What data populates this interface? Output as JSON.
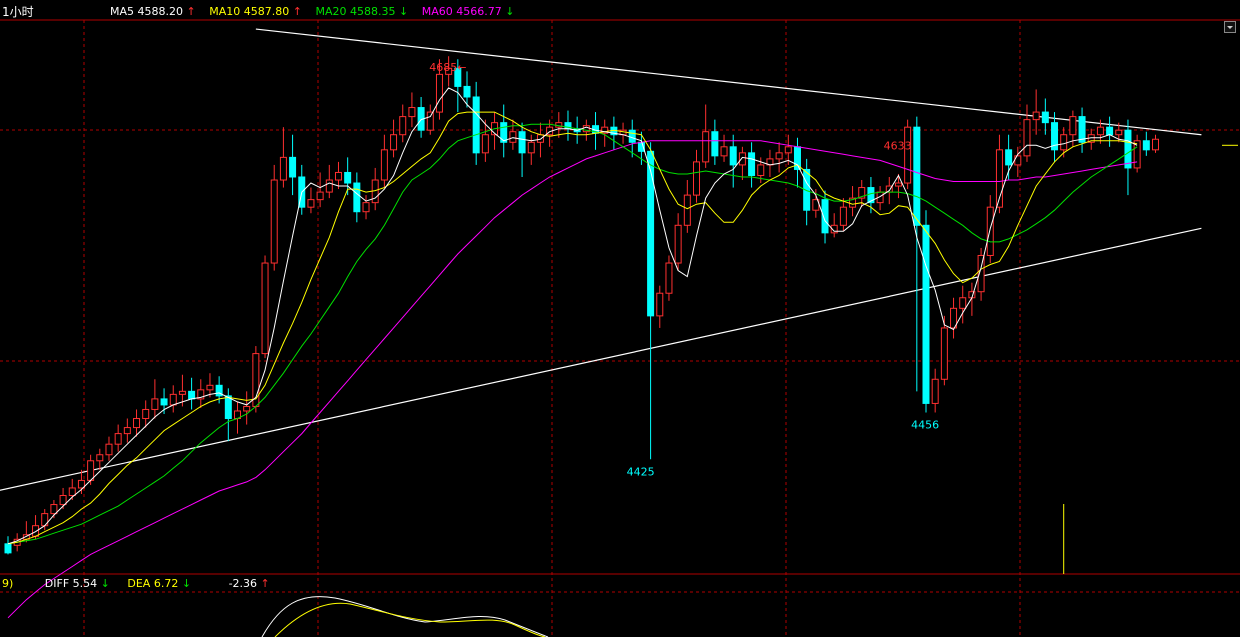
{
  "period_label": "1小时",
  "ma_legend": [
    {
      "label": "MA5",
      "value": "4588.20",
      "arrow": "↑",
      "color": "#ffffff",
      "arrow_color": "#ff3030"
    },
    {
      "label": "MA10",
      "value": "4587.80",
      "arrow": "↑",
      "color": "#ffff00",
      "arrow_color": "#ff3030"
    },
    {
      "label": "MA20",
      "value": "4588.35",
      "arrow": "↓",
      "color": "#00e000",
      "arrow_color": "#00e000"
    },
    {
      "label": "MA60",
      "value": "4566.77",
      "arrow": "↓",
      "color": "#ff00ff",
      "arrow_color": "#00e000"
    }
  ],
  "macd_legend": {
    "prefix": "9)",
    "diff_label": "DIFF",
    "diff_value": "5.54",
    "diff_arrow": "↓",
    "dea_label": "DEA",
    "dea_value": "6.72",
    "dea_arrow": "↓",
    "macd_value": "-2.36",
    "macd_arrow": "↑"
  },
  "colors": {
    "up": "#ff3030",
    "down": "#00ffff",
    "grid": "#b00000",
    "ma5": "#ffffff",
    "ma10": "#ffff00",
    "ma20": "#00e000",
    "ma60": "#ff00ff",
    "trendline": "#ffffff",
    "label_high": "#ff3030",
    "label_low": "#00ffff"
  },
  "chart_data": {
    "type": "candlestick",
    "ylim": [
      4349,
      4716
    ],
    "price_labels": [
      {
        "text": "4685←",
        "price": 4685,
        "bar": 49
      },
      {
        "text": "4633",
        "price": 4633,
        "bar": 98
      },
      {
        "text": "4425",
        "price": 4425,
        "bar": 70
      },
      {
        "text": "4456",
        "price": 4456,
        "bar": 101
      }
    ],
    "candles": [
      [
        4369,
        4374,
        4363,
        4362
      ],
      [
        4368,
        4376,
        4372,
        4364
      ],
      [
        4372,
        4384,
        4375,
        4370
      ],
      [
        4374,
        4388,
        4381,
        4372
      ],
      [
        4381,
        4392,
        4389,
        4378
      ],
      [
        4389,
        4398,
        4395,
        4386
      ],
      [
        4395,
        4406,
        4401,
        4392
      ],
      [
        4401,
        4412,
        4406,
        4398
      ],
      [
        4406,
        4418,
        4411,
        4402
      ],
      [
        4411,
        4428,
        4424,
        4408
      ],
      [
        4424,
        4432,
        4428,
        4418
      ],
      [
        4428,
        4440,
        4435,
        4424
      ],
      [
        4435,
        4448,
        4442,
        4430
      ],
      [
        4442,
        4452,
        4446,
        4436
      ],
      [
        4446,
        4458,
        4452,
        4440
      ],
      [
        4452,
        4464,
        4458,
        4446
      ],
      [
        4458,
        4478,
        4465,
        4452
      ],
      [
        4465,
        4472,
        4461,
        4455
      ],
      [
        4461,
        4474,
        4468,
        4456
      ],
      [
        4468,
        4481,
        4470,
        4460
      ],
      [
        4470,
        4479,
        4465,
        4458
      ],
      [
        4465,
        4478,
        4471,
        4459
      ],
      [
        4471,
        4482,
        4474,
        4466
      ],
      [
        4474,
        4480,
        4467,
        4462
      ],
      [
        4467,
        4472,
        4452,
        4437
      ],
      [
        4452,
        4463,
        4457,
        4442
      ],
      [
        4457,
        4470,
        4460,
        4448
      ],
      [
        4460,
        4500,
        4495,
        4456
      ],
      [
        4495,
        4560,
        4555,
        4492
      ],
      [
        4555,
        4620,
        4610,
        4550
      ],
      [
        4610,
        4645,
        4625,
        4605
      ],
      [
        4625,
        4640,
        4612,
        4600
      ],
      [
        4612,
        4620,
        4592,
        4587
      ],
      [
        4592,
        4605,
        4597,
        4588
      ],
      [
        4597,
        4615,
        4602,
        4592
      ],
      [
        4602,
        4620,
        4610,
        4598
      ],
      [
        4610,
        4622,
        4615,
        4604
      ],
      [
        4615,
        4625,
        4608,
        4600
      ],
      [
        4608,
        4615,
        4589,
        4582
      ],
      [
        4589,
        4600,
        4595,
        4584
      ],
      [
        4595,
        4618,
        4610,
        4590
      ],
      [
        4610,
        4640,
        4630,
        4605
      ],
      [
        4630,
        4650,
        4640,
        4625
      ],
      [
        4640,
        4660,
        4652,
        4635
      ],
      [
        4652,
        4668,
        4658,
        4645
      ],
      [
        4658,
        4665,
        4643,
        4638
      ],
      [
        4643,
        4660,
        4655,
        4640
      ],
      [
        4655,
        4690,
        4680,
        4650
      ],
      [
        4680,
        4692,
        4684,
        4672
      ],
      [
        4684,
        4690,
        4672,
        4655
      ],
      [
        4672,
        4682,
        4665,
        4658
      ],
      [
        4665,
        4675,
        4628,
        4620
      ],
      [
        4628,
        4650,
        4640,
        4622
      ],
      [
        4640,
        4655,
        4648,
        4630
      ],
      [
        4648,
        4660,
        4635,
        4625
      ],
      [
        4635,
        4650,
        4642,
        4630
      ],
      [
        4642,
        4648,
        4628,
        4612
      ],
      [
        4628,
        4640,
        4635,
        4620
      ],
      [
        4635,
        4648,
        4640,
        4625
      ],
      [
        4640,
        4650,
        4645,
        4632
      ],
      [
        4645,
        4655,
        4648,
        4638
      ],
      [
        4648,
        4656,
        4644,
        4636
      ],
      [
        4644,
        4652,
        4642,
        4634
      ],
      [
        4642,
        4650,
        4646,
        4636
      ],
      [
        4646,
        4655,
        4641,
        4630
      ],
      [
        4641,
        4650,
        4645,
        4632
      ],
      [
        4645,
        4652,
        4640,
        4630
      ],
      [
        4640,
        4648,
        4643,
        4634
      ],
      [
        4643,
        4650,
        4635,
        4625
      ],
      [
        4635,
        4642,
        4629,
        4620
      ],
      [
        4629,
        4635,
        4520,
        4425
      ],
      [
        4520,
        4540,
        4535,
        4512
      ],
      [
        4535,
        4560,
        4555,
        4530
      ],
      [
        4555,
        4588,
        4580,
        4550
      ],
      [
        4580,
        4610,
        4600,
        4575
      ],
      [
        4600,
        4630,
        4622,
        4595
      ],
      [
        4622,
        4660,
        4642,
        4618
      ],
      [
        4642,
        4650,
        4626,
        4620
      ],
      [
        4626,
        4640,
        4632,
        4622
      ],
      [
        4632,
        4640,
        4620,
        4605
      ],
      [
        4620,
        4632,
        4628,
        4610
      ],
      [
        4628,
        4635,
        4613,
        4605
      ],
      [
        4613,
        4625,
        4620,
        4608
      ],
      [
        4620,
        4630,
        4624,
        4612
      ],
      [
        4624,
        4635,
        4628,
        4615
      ],
      [
        4628,
        4640,
        4632,
        4620
      ],
      [
        4632,
        4638,
        4617,
        4605
      ],
      [
        4617,
        4624,
        4590,
        4580
      ],
      [
        4590,
        4604,
        4597,
        4585
      ],
      [
        4597,
        4603,
        4575,
        4568
      ],
      [
        4575,
        4588,
        4580,
        4572
      ],
      [
        4580,
        4598,
        4592,
        4576
      ],
      [
        4592,
        4606,
        4598,
        4586
      ],
      [
        4598,
        4610,
        4605,
        4592
      ],
      [
        4605,
        4612,
        4595,
        4588
      ],
      [
        4595,
        4606,
        4602,
        4590
      ],
      [
        4602,
        4612,
        4606,
        4594
      ],
      [
        4606,
        4614,
        4608,
        4598
      ],
      [
        4608,
        4650,
        4645,
        4604
      ],
      [
        4645,
        4652,
        4580,
        4470
      ],
      [
        4580,
        4590,
        4462,
        4456
      ],
      [
        4462,
        4485,
        4478,
        4456
      ],
      [
        4478,
        4520,
        4512,
        4474
      ],
      [
        4512,
        4532,
        4525,
        4505
      ],
      [
        4525,
        4540,
        4532,
        4515
      ],
      [
        4532,
        4542,
        4536,
        4520
      ],
      [
        4536,
        4565,
        4560,
        4530
      ],
      [
        4560,
        4600,
        4592,
        4555
      ],
      [
        4592,
        4640,
        4630,
        4588
      ],
      [
        4630,
        4640,
        4620,
        4610
      ],
      [
        4620,
        4632,
        4626,
        4612
      ],
      [
        4626,
        4660,
        4650,
        4622
      ],
      [
        4650,
        4670,
        4655,
        4640
      ],
      [
        4655,
        4664,
        4648,
        4640
      ],
      [
        4648,
        4655,
        4630,
        4622
      ],
      [
        4630,
        4645,
        4640,
        4625
      ],
      [
        4640,
        4656,
        4652,
        4632
      ],
      [
        4652,
        4658,
        4635,
        4628
      ],
      [
        4635,
        4644,
        4640,
        4630
      ],
      [
        4640,
        4650,
        4645,
        4634
      ],
      [
        4645,
        4652,
        4640,
        4632
      ],
      [
        4640,
        4648,
        4643,
        4635
      ],
      [
        4643,
        4650,
        4618,
        4600
      ],
      [
        4618,
        4640,
        4636,
        4615
      ],
      [
        4636,
        4642,
        4630,
        4626
      ],
      [
        4630,
        4640,
        4637,
        4628
      ]
    ],
    "ma5": [
      4369,
      4371,
      4374,
      4377,
      4381,
      4388,
      4394,
      4400,
      4405,
      4411,
      4417,
      4423,
      4429,
      4435,
      4441,
      4447,
      4453,
      4458,
      4461,
      4463,
      4465,
      4466,
      4468,
      4469,
      4466,
      4463,
      4461,
      4466,
      4484,
      4512,
      4543,
      4573,
      4602,
      4608,
      4605,
      4608,
      4606,
      4606,
      4601,
      4596,
      4598,
      4604,
      4613,
      4628,
      4642,
      4650,
      4652,
      4663,
      4671,
      4668,
      4660,
      4654,
      4647,
      4641,
      4636,
      4638,
      4637,
      4636,
      4637,
      4642,
      4644,
      4644,
      4643,
      4645,
      4643,
      4642,
      4641,
      4640,
      4638,
      4636,
      4616,
      4590,
      4565,
      4550,
      4546,
      4573,
      4598,
      4608,
      4614,
      4617,
      4625,
      4624,
      4622,
      4620,
      4621,
      4623,
      4620,
      4608,
      4600,
      4583,
      4576,
      4576,
      4581,
      4593,
      4596,
      4599,
      4603,
      4613,
      4600,
      4572,
      4553,
      4537,
      4514,
      4511,
      4522,
      4532,
      4552,
      4578,
      4598,
      4616,
      4627,
      4633,
      4633,
      4631,
      4633,
      4634,
      4636,
      4637,
      4638,
      4638,
      4640,
      4637,
      4636,
      4633
    ],
    "ma10": [
      4369,
      4370,
      4372,
      4374,
      4377,
      4380,
      4383,
      4387,
      4392,
      4396,
      4402,
      4409,
      4415,
      4421,
      4426,
      4432,
      4438,
      4444,
      4448,
      4452,
      4456,
      4460,
      4463,
      4465,
      4466,
      4465,
      4464,
      4465,
      4474,
      4488,
      4502,
      4515,
      4529,
      4544,
      4558,
      4572,
      4589,
      4604,
      4604,
      4602,
      4603,
      4605,
      4609,
      4614,
      4619,
      4624,
      4628,
      4638,
      4649,
      4654,
      4655,
      4655,
      4655,
      4655,
      4652,
      4649,
      4645,
      4642,
      4640,
      4639,
      4640,
      4641,
      4640,
      4640,
      4641,
      4642,
      4643,
      4642,
      4641,
      4640,
      4630,
      4617,
      4604,
      4594,
      4591,
      4594,
      4595,
      4588,
      4582,
      4582,
      4590,
      4600,
      4606,
      4610,
      4613,
      4618,
      4620,
      4615,
      4610,
      4601,
      4598,
      4596,
      4594,
      4595,
      4592,
      4587,
      4588,
      4593,
      4592,
      4584,
      4576,
      4568,
      4557,
      4548,
      4542,
      4545,
      4551,
      4554,
      4556,
      4566,
      4580,
      4593,
      4606,
      4614,
      4622,
      4628,
      4632,
      4634,
      4636,
      4636,
      4636,
      4636,
      4635,
      4634
    ],
    "ma20": [
      4369,
      4370,
      4371,
      4372,
      4374,
      4376,
      4378,
      4380,
      4382,
      4385,
      4388,
      4391,
      4394,
      4398,
      4402,
      4406,
      4410,
      4414,
      4419,
      4424,
      4430,
      4436,
      4441,
      4446,
      4450,
      4452,
      4455,
      4460,
      4466,
      4474,
      4482,
      4491,
      4500,
      4508,
      4517,
      4526,
      4535,
      4546,
      4556,
      4564,
      4571,
      4580,
      4591,
      4602,
      4610,
      4614,
      4618,
      4624,
      4631,
      4636,
      4638,
      4640,
      4642,
      4644,
      4645,
      4646,
      4646,
      4647,
      4647,
      4647,
      4646,
      4645,
      4644,
      4643,
      4642,
      4640,
      4636,
      4632,
      4628,
      4624,
      4620,
      4617,
      4615,
      4614,
      4614,
      4615,
      4616,
      4615,
      4614,
      4613,
      4612,
      4612,
      4611,
      4610,
      4609,
      4608,
      4606,
      4603,
      4601,
      4598,
      4596,
      4596,
      4597,
      4599,
      4601,
      4602,
      4602,
      4602,
      4601,
      4599,
      4596,
      4592,
      4588,
      4584,
      4580,
      4575,
      4571,
      4569,
      4569,
      4571,
      4574,
      4577,
      4581,
      4585,
      4590,
      4596,
      4602,
      4607,
      4612,
      4616,
      4620,
      4624,
      4628,
      4632
    ],
    "ma60": [
      4320,
      4326,
      4332,
      4337,
      4342,
      4346,
      4350,
      4354,
      4358,
      4362,
      4365,
      4368,
      4371,
      4374,
      4377,
      4380,
      4383,
      4386,
      4389,
      4392,
      4395,
      4398,
      4401,
      4404,
      4406,
      4408,
      4410,
      4413,
      4418,
      4424,
      4430,
      4436,
      4442,
      4449,
      4456,
      4463,
      4470,
      4477,
      4484,
      4491,
      4498,
      4505,
      4512,
      4519,
      4526,
      4533,
      4540,
      4547,
      4554,
      4561,
      4567,
      4573,
      4579,
      4585,
      4590,
      4595,
      4600,
      4604,
      4608,
      4612,
      4615,
      4618,
      4621,
      4624,
      4626,
      4628,
      4630,
      4632,
      4634,
      4635,
      4636,
      4636,
      4636,
      4636,
      4636,
      4636,
      4636,
      4636,
      4636,
      4636,
      4636,
      4636,
      4636,
      4635,
      4634,
      4633,
      4632,
      4631,
      4630,
      4629,
      4628,
      4627,
      4626,
      4625,
      4624,
      4623,
      4621,
      4619,
      4617,
      4615,
      4613,
      4611,
      4610,
      4609,
      4609,
      4609,
      4609,
      4609,
      4609,
      4610,
      4610,
      4611,
      4612,
      4612,
      4613,
      4614,
      4615,
      4616,
      4617,
      4618,
      4619,
      4620,
      4621,
      4622
    ],
    "trendlines": [
      {
        "from": {
          "bar": 27,
          "price": 4710
        },
        "to": {
          "bar": 130,
          "price": 4640
        }
      },
      {
        "from": {
          "bar": -2,
          "price": 4403
        },
        "to": {
          "bar": 130,
          "price": 4578
        }
      }
    ],
    "last_price_mark": 4633,
    "volume_spike": {
      "bar": 115
    }
  }
}
